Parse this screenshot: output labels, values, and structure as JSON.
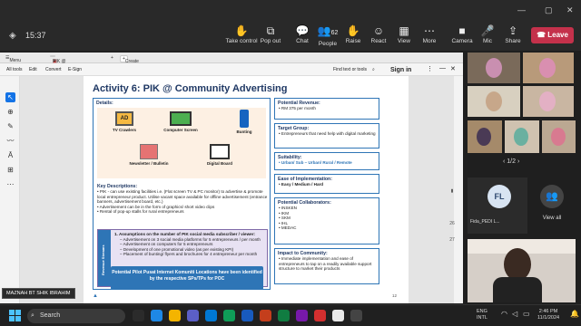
{
  "teams": {
    "time": "15:37",
    "buttons": [
      {
        "label": "Take control",
        "icon": "take-control-icon"
      },
      {
        "label": "Pop out",
        "icon": "pop-out-icon"
      },
      {
        "label": "Chat",
        "icon": "chat-icon"
      },
      {
        "label": "People",
        "icon": "people-icon",
        "count": "62"
      },
      {
        "label": "Raise",
        "icon": "raise-hand-icon"
      },
      {
        "label": "React",
        "icon": "react-icon"
      },
      {
        "label": "View",
        "icon": "view-icon"
      },
      {
        "label": "More",
        "icon": "more-icon"
      },
      {
        "label": "Camera",
        "icon": "camera-icon"
      },
      {
        "label": "Mic",
        "icon": "mic-icon"
      },
      {
        "label": "Share",
        "icon": "share-icon"
      }
    ],
    "leave_label": "Leave",
    "accent": "#c4314b"
  },
  "browser": {
    "menu_label": "Menu",
    "tab_title": "PIK @ Charters - Revenu...",
    "new_tab": "+",
    "create_label": "Create"
  },
  "acrobat": {
    "menus": [
      "All tools",
      "Edit",
      "Convert",
      "E-Sign"
    ],
    "find_label": "Find text or tools",
    "signin_label": "Sign in",
    "page_numbers": [
      "26",
      "27"
    ],
    "page_of": "1"
  },
  "slide": {
    "title": "Activity 6: PIK @ Community Advertising",
    "details_label": "Details:",
    "icons": [
      {
        "label": "TV Crawlers",
        "icon": "tv-crawler-icon"
      },
      {
        "label": "Computer Screen",
        "icon": "computer-screen-icon"
      },
      {
        "label": "Bunting",
        "icon": "bunting-icon"
      },
      {
        "label": "Newsletter / Bulletin",
        "icon": "newsletter-icon"
      },
      {
        "label": "Digital Board",
        "icon": "digital-board-icon"
      }
    ],
    "key_desc_label": "Key Descriptions:",
    "key_descriptions": [
      "PIK - can use existing facilities i.e. (Flat screen TV & PC monitor) to advertise & promote local entrepreneur product. Utilise vacant space available for offline advertisement (entrance banners, advertisement board, etc.)",
      "Advertisement can be in the form of graphics/ short video clips",
      "Rental of pop-up stalls for rural entrepreneurs"
    ],
    "side_tab_label": "Revenue Streams",
    "assumptions_title": "Assumptions on the number of PIK social media subscriber / viewer:",
    "assumptions": [
      "Advertisement on 3 social media platforms for 5 entrepreneurs / per month",
      "Advertisement on computers for 5 entrepreneurs",
      "Development of one promotional video (as per existing KPI)",
      "Placement of bunting/ flyers and brochures for 4 entrepreneur per month"
    ],
    "banner": "Potential Pilot Pusat Internet Komuniti Locations have been identified by the respective SPs/TPs for POC",
    "potential_revenue_label": "Potential Revenue:",
    "potential_revenue": "RM 375 per month",
    "target_group_label": "Target Group:",
    "target_group": "Entrepreneurs that need help with digital marketing",
    "suitability_label": "Suitability:",
    "suitability": "Urban/ Sub – Urban/ Rural / Remote",
    "ease_label": "Ease of Implementation:",
    "ease": "Easy / Medium / Hard",
    "collab_label": "Potential Collaborators:",
    "collaborators": [
      "INSKEN",
      "IKM",
      "SKM",
      "IHL",
      "MEDAC"
    ],
    "impact_label": "Impact to Community:",
    "impact": "Immediate implementation and ease of entrepreneurs to tap on a readily available support structure to market their products",
    "page_number": "12",
    "accent": "#2e75b6"
  },
  "presenter_name": "MAZNAH BT SHIK IBRAHIM",
  "gallery": {
    "pager": "1/2",
    "fl_initials": "FL",
    "fl_name": "Fida_PEDI L...",
    "view_all": "View all"
  },
  "taskbar": {
    "search_placeholder": "Search",
    "lang": "ENG",
    "lang_sub": "INTL",
    "clock_time": "2:46 PM",
    "clock_date": "11/1/2024"
  }
}
